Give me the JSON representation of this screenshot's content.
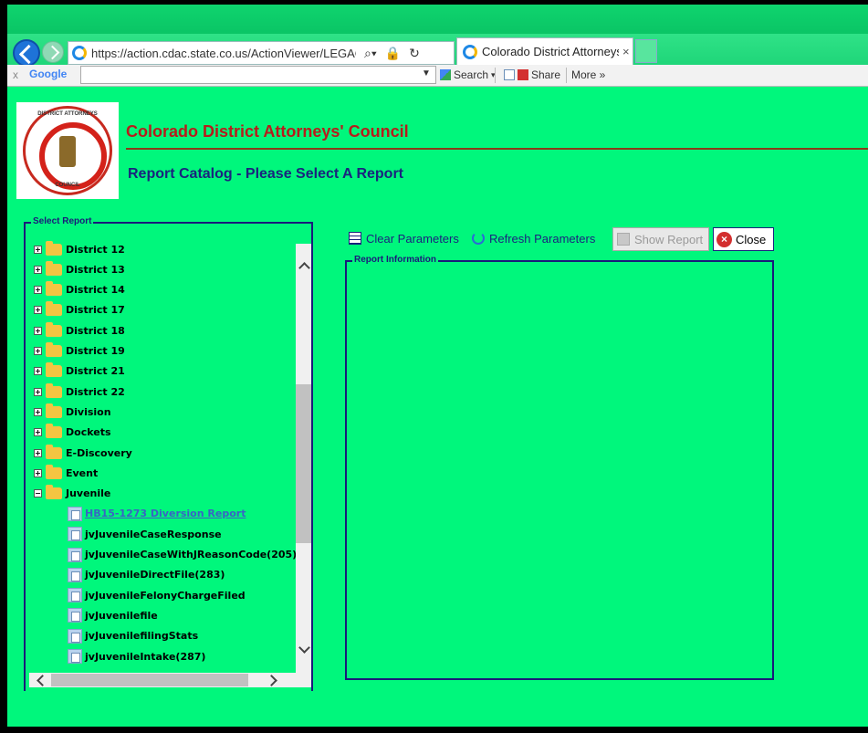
{
  "browser": {
    "url": "https://action.cdac.state.co.us/ActionViewer/LEGACY_Catalo",
    "tab_title": "Colorado District Attorneys ...",
    "tab_close": "×"
  },
  "google_bar": {
    "close": "x",
    "logo": "Google",
    "search_label": "Search",
    "share_label": "Share",
    "more_label": "More »"
  },
  "header": {
    "org_title": "Colorado District Attorneys' Council",
    "subtitle": "Report Catalog - Please Select A Report",
    "seal_top": "DISTRICT ATTORNEYS",
    "seal_bottom": "COUNCIL"
  },
  "select_report": {
    "legend": "Select Report",
    "folders": [
      {
        "label": "District 12",
        "expanded": false
      },
      {
        "label": "District 13",
        "expanded": false
      },
      {
        "label": "District 14",
        "expanded": false
      },
      {
        "label": "District 17",
        "expanded": false
      },
      {
        "label": "District 18",
        "expanded": false
      },
      {
        "label": "District 19",
        "expanded": false
      },
      {
        "label": "District 21",
        "expanded": false
      },
      {
        "label": "District 22",
        "expanded": false
      },
      {
        "label": "Division",
        "expanded": false
      },
      {
        "label": "Dockets",
        "expanded": false
      },
      {
        "label": "E-Discovery",
        "expanded": false
      },
      {
        "label": "Event",
        "expanded": false
      },
      {
        "label": "Juvenile",
        "expanded": true
      }
    ],
    "reports": [
      {
        "label": "HB15-1273 Diversion Report",
        "link": true
      },
      {
        "label": "jvJuvenileCaseResponse",
        "link": false
      },
      {
        "label": "jvJuvenileCaseWithJReasonCode(205)",
        "link": false
      },
      {
        "label": "jvJuvenileDirectFile(283)",
        "link": false
      },
      {
        "label": "jvJuvenileFelonyChargeFiled",
        "link": false
      },
      {
        "label": "jvJuvenilefile",
        "link": false
      },
      {
        "label": "jvJuvenilefilingStats",
        "link": false
      },
      {
        "label": "jvJuvenileIntake(287)",
        "link": false
      }
    ]
  },
  "toolbar": {
    "clear_label": "Clear Parameters",
    "refresh_label": "Refresh Parameters",
    "show_report_label": "Show Report",
    "close_label": "Close",
    "close_icon_glyph": "×"
  },
  "report_info": {
    "legend": "Report Information"
  }
}
